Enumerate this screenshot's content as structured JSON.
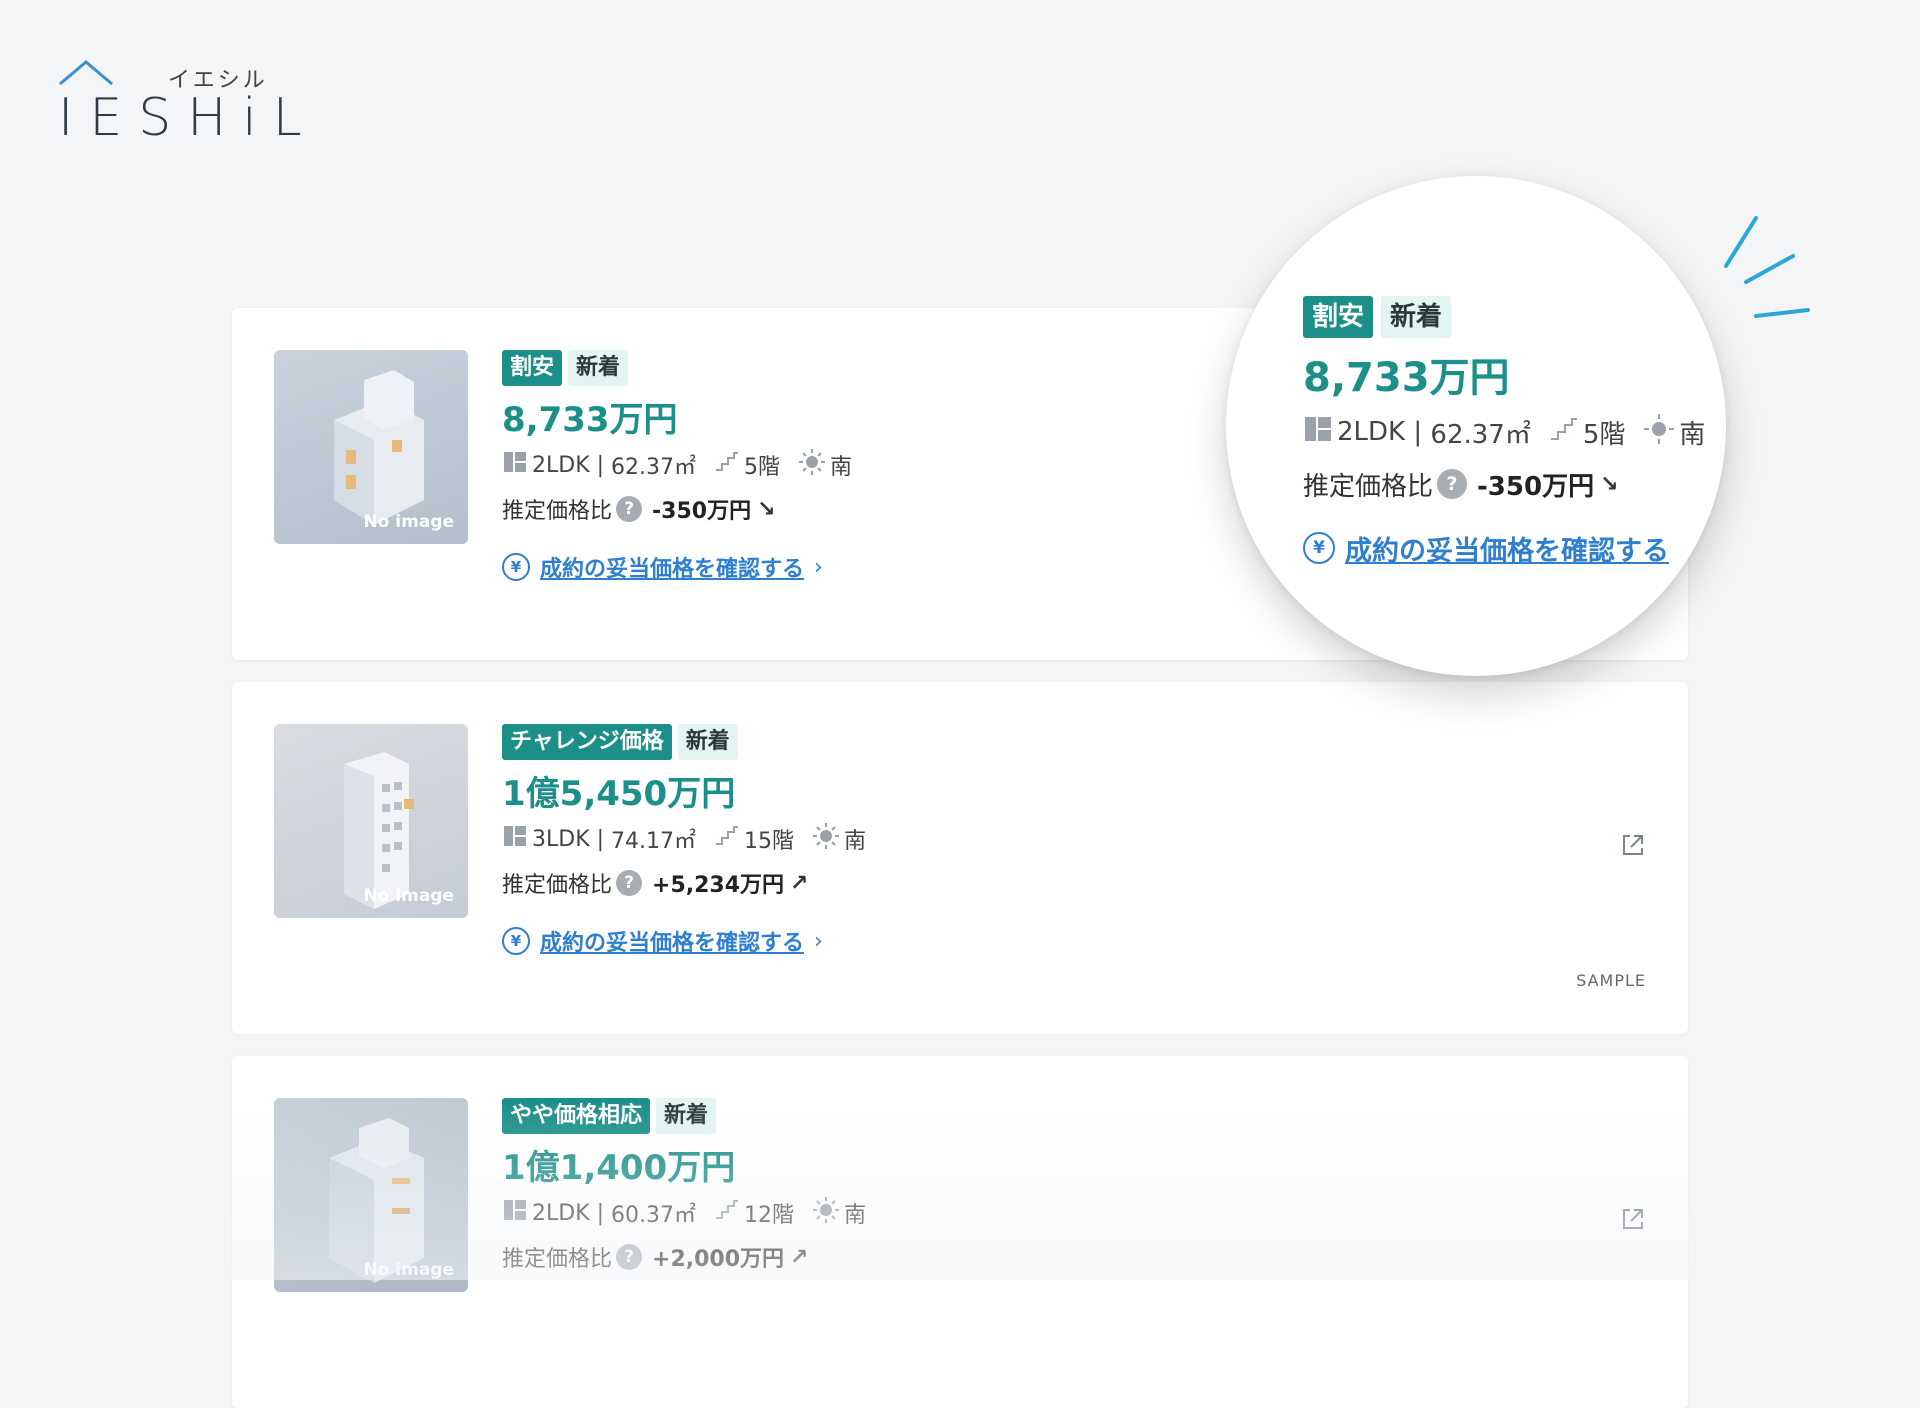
{
  "logo": {
    "kana": "イエシル",
    "word": "IESHiL"
  },
  "listings": [
    {
      "tag": "割安",
      "new_tag": "新着",
      "price": "8,733万円",
      "layout": "2LDK",
      "area": "62.37㎡",
      "floor": "5階",
      "direction": "南",
      "ratio_label": "推定価格比",
      "help": "?",
      "diff": "-350万円",
      "arrow": "↘",
      "link": "成約の妥当価格を確認する",
      "no_image": "No image"
    },
    {
      "tag": "チャレンジ価格",
      "new_tag": "新着",
      "price": "1億5,450万円",
      "layout": "3LDK",
      "area": "74.17㎡",
      "floor": "15階",
      "direction": "南",
      "ratio_label": "推定価格比",
      "help": "?",
      "diff": "+5,234万円",
      "arrow": "↗",
      "link": "成約の妥当価格を確認する",
      "no_image": "No image",
      "sample": "SAMPLE"
    },
    {
      "tag": "やや価格相応",
      "new_tag": "新着",
      "price": "1億1,400万円",
      "layout": "2LDK",
      "area": "60.37㎡",
      "floor": "12階",
      "direction": "南",
      "ratio_label": "推定価格比",
      "help": "?",
      "diff": "+2,000万円",
      "arrow": "↗",
      "no_image": "No image"
    }
  ],
  "magnifier": {
    "tag": "割安",
    "new_tag": "新着",
    "price": "8,733万円",
    "layout": "2LDK",
    "area": "62.37㎡",
    "floor": "5階",
    "direction": "南",
    "ratio_label": "推定価格比",
    "help": "?",
    "diff": "-350万円",
    "arrow": "↘",
    "link": "成約の妥当価格を確認する"
  },
  "colors": {
    "accent": "#1c8f89",
    "link": "#2f7fd1",
    "background": "#f3f5f7"
  }
}
